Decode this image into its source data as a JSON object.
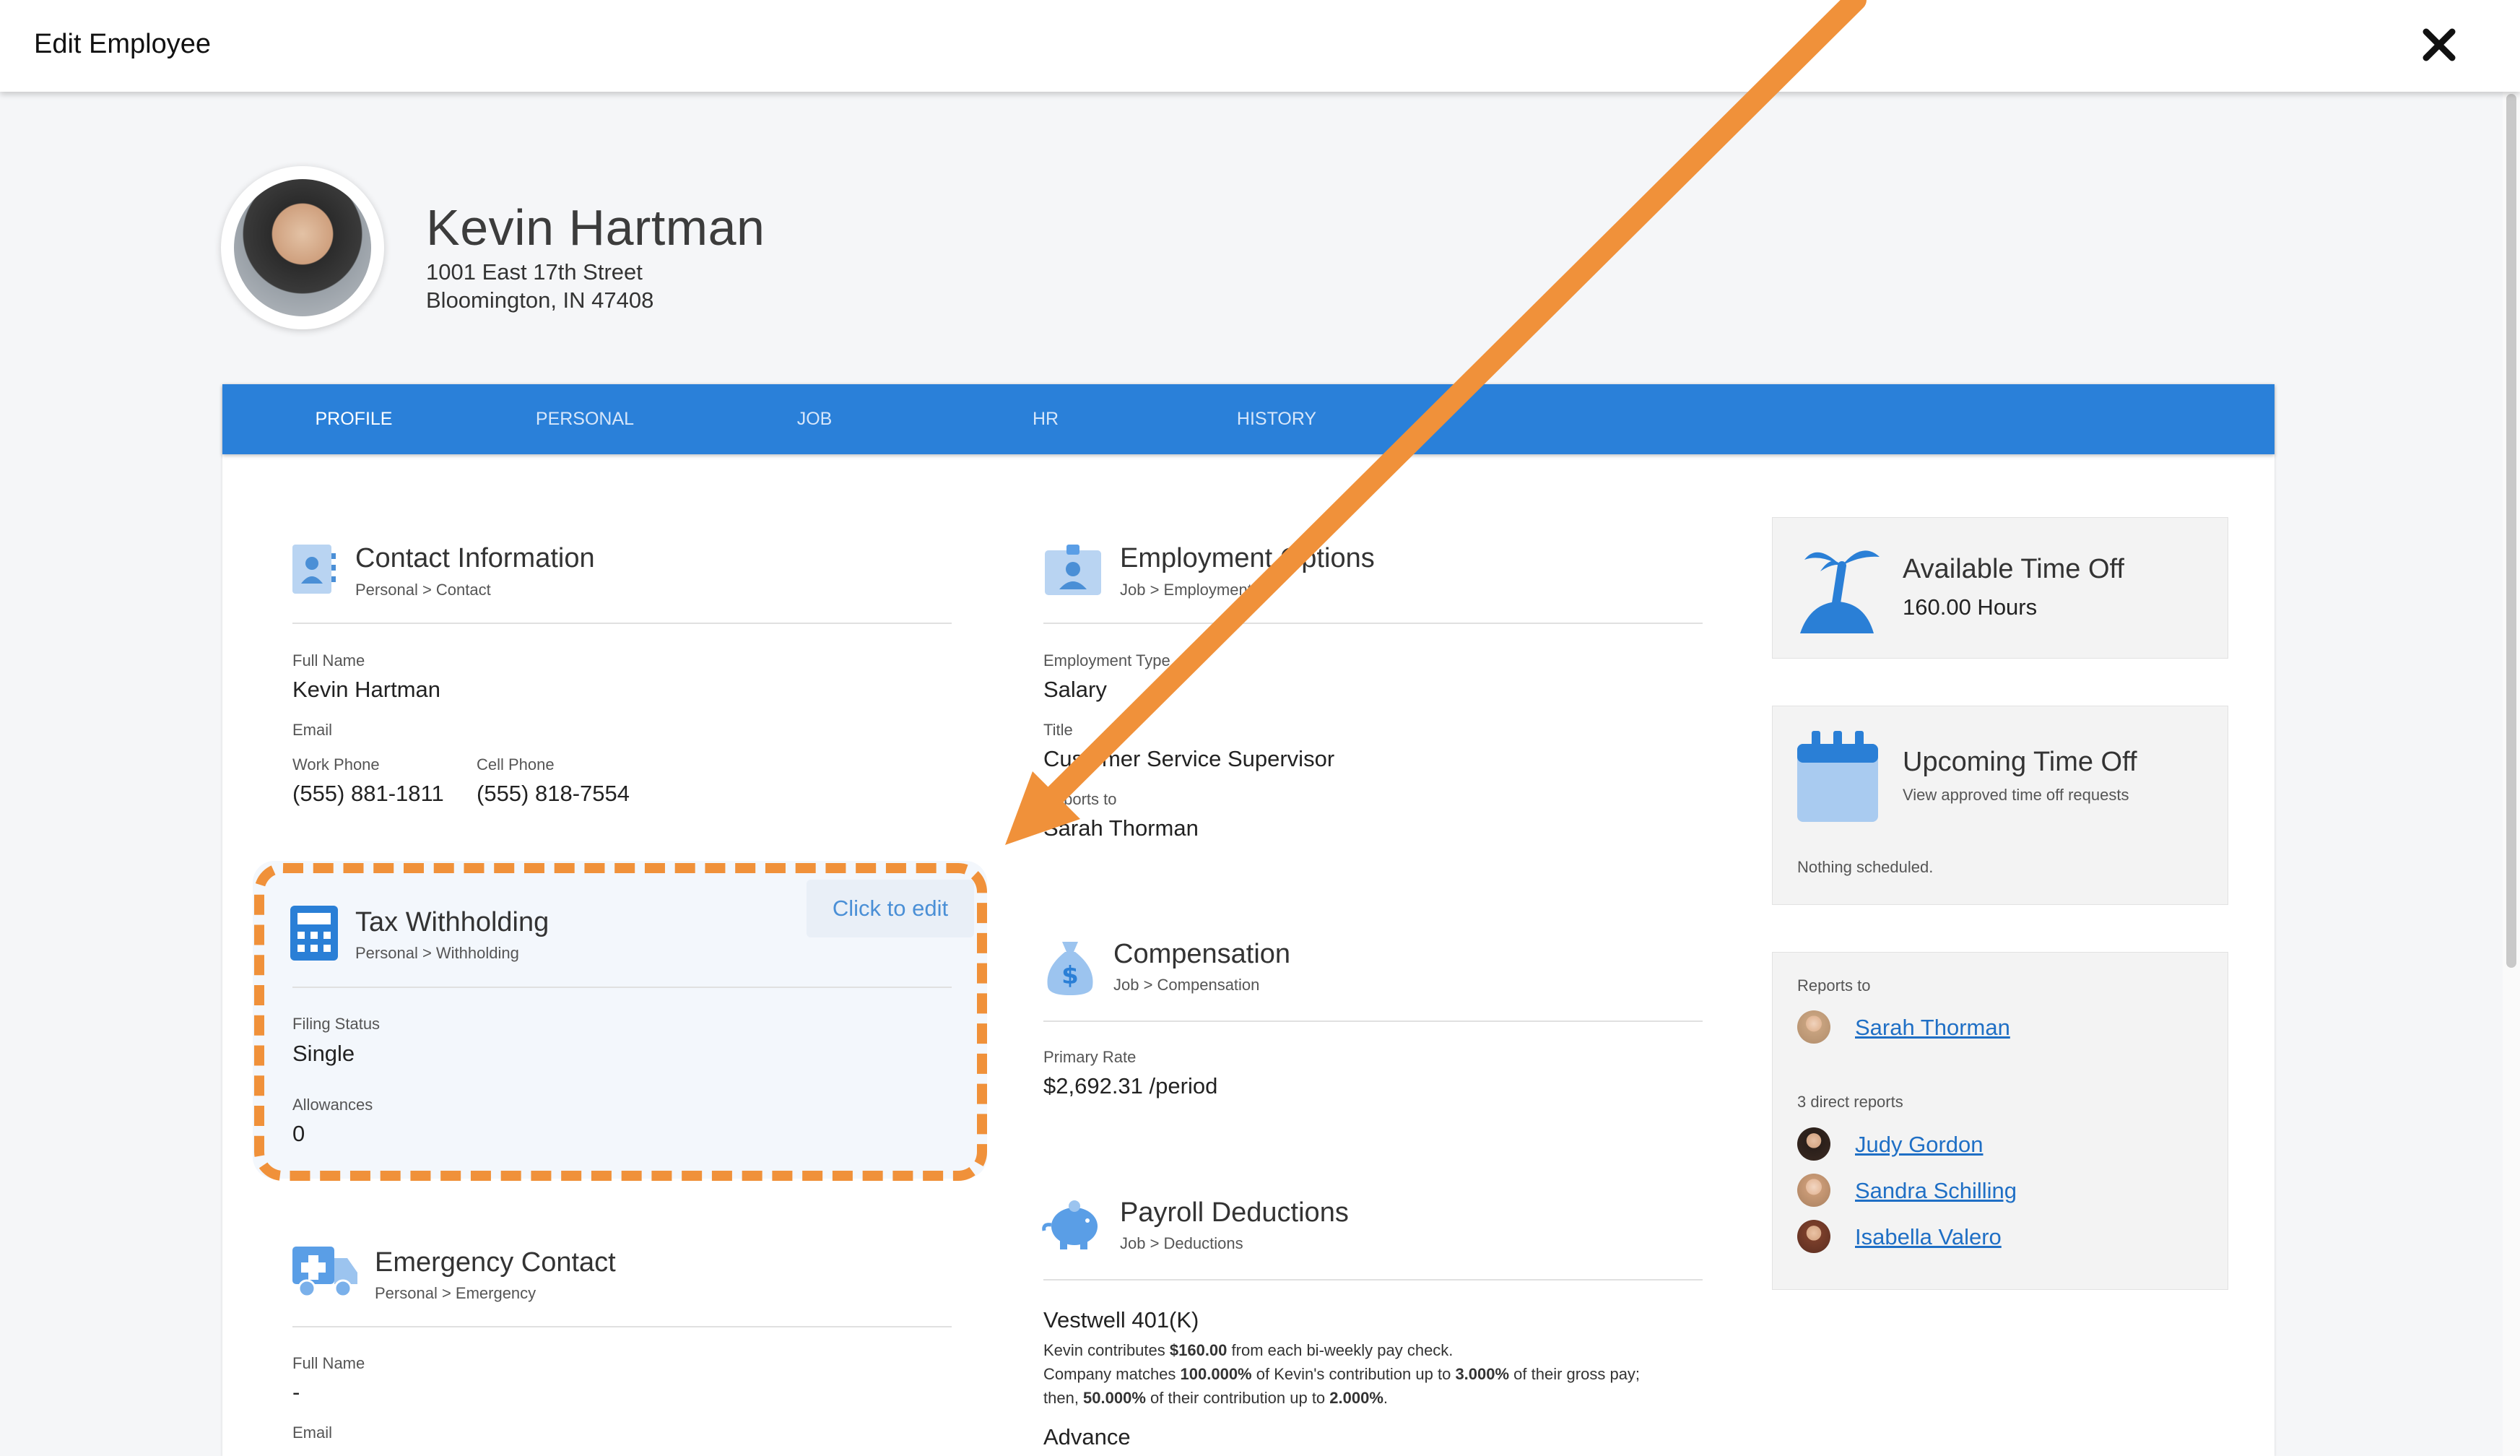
{
  "window": {
    "title": "Edit Employee",
    "close_icon": "close-icon"
  },
  "employee": {
    "name": "Kevin Hartman",
    "address_line1": "1001 East 17th Street",
    "address_line2": "Bloomington, IN 47408"
  },
  "tabs": [
    {
      "label": "PROFILE",
      "active": true
    },
    {
      "label": "PERSONAL",
      "active": false
    },
    {
      "label": "JOB",
      "active": false
    },
    {
      "label": "HR",
      "active": false
    },
    {
      "label": "HISTORY",
      "active": false
    }
  ],
  "contact": {
    "title": "Contact Information",
    "subtitle": "Personal > Contact",
    "full_name_label": "Full Name",
    "full_name": "Kevin Hartman",
    "email_label": "Email",
    "work_phone_label": "Work Phone",
    "work_phone": "(555) 881-1811",
    "cell_phone_label": "Cell Phone",
    "cell_phone": "(555) 818-7554"
  },
  "tax": {
    "title": "Tax Withholding",
    "subtitle": "Personal > Withholding",
    "edit_label": "Click to edit",
    "filing_status_label": "Filing Status",
    "filing_status": "Single",
    "allowances_label": "Allowances",
    "allowances": "0"
  },
  "emergency": {
    "title": "Emergency Contact",
    "subtitle": "Personal > Emergency",
    "full_name_label": "Full Name",
    "full_name": "-",
    "email_label": "Email"
  },
  "employment": {
    "title": "Employment Options",
    "subtitle": "Job > Employment",
    "type_label": "Employment Type",
    "type": "Salary",
    "title_label": "Title",
    "job_title": "Customer Service Supervisor",
    "reports_to_label": "Reports to",
    "reports_to": "Sarah Thorman"
  },
  "compensation": {
    "title": "Compensation",
    "subtitle": "Job > Compensation",
    "rate_label": "Primary Rate",
    "rate": "$2,692.31 /period"
  },
  "payroll": {
    "title": "Payroll Deductions",
    "subtitle": "Job > Deductions",
    "plan_name": "Vestwell 401(K)",
    "line1_pre": "Kevin contributes ",
    "line1_amount": "$160.00",
    "line1_post": " from each bi-weekly pay check.",
    "line2_pre": "Company matches ",
    "line2_pct": "100.000%",
    "line2_mid": " of Kevin's contribution up to ",
    "line2_cap": "3.000%",
    "line2_post": " of their gross pay;",
    "line3_pre": "then, ",
    "line3_pct": "50.000%",
    "line3_mid": " of their contribution up to ",
    "line3_cap": "2.000%",
    "line3_post": ".",
    "next_item": "Advance"
  },
  "available_time_off": {
    "title": "Available Time Off",
    "value": "160.00 Hours"
  },
  "upcoming_time_off": {
    "title": "Upcoming Time Off",
    "subtitle": "View approved time off requests",
    "empty_text": "Nothing scheduled."
  },
  "org": {
    "reports_to_label": "Reports to",
    "manager": "Sarah Thorman",
    "direct_reports_label": "3 direct reports",
    "direct_reports": [
      "Judy Gordon",
      "Sandra Schilling",
      "Isabella Valero"
    ]
  },
  "colors": {
    "brand_blue": "#2a80d9",
    "accent_orange": "#f0913a",
    "link_blue": "#1f6fc5",
    "icon_blue": "#5a9ee6"
  }
}
